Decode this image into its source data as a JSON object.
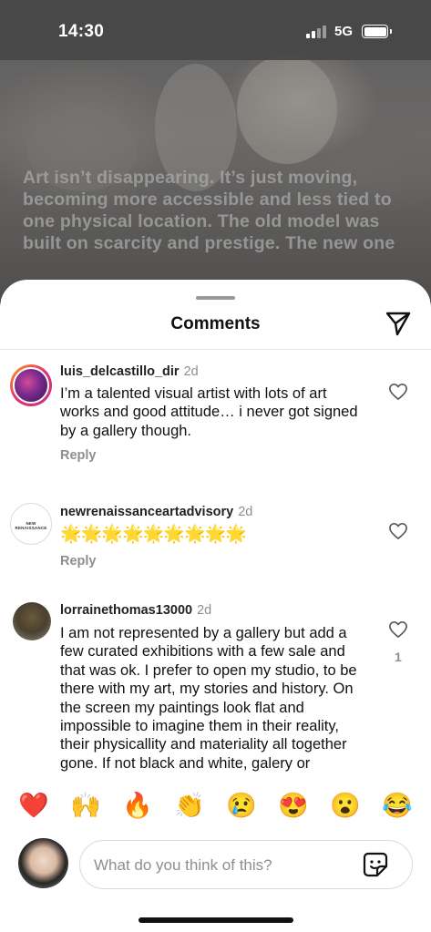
{
  "status_bar": {
    "time": "14:30",
    "network": "5G"
  },
  "post": {
    "caption": "Art isn’t disappearing. It’s just moving, becoming more accessible and less tied to one physical location. The old model was built on scarcity and prestige. The new one"
  },
  "sheet": {
    "title": "Comments",
    "share_icon": "send-icon"
  },
  "comments": [
    {
      "username": "luis_delcastillo_dir",
      "age": "2d",
      "text": "I’m a talented visual artist with lots of art works and good attitude… i never got signed by a gallery though.",
      "reply_label": "Reply",
      "likes": ""
    },
    {
      "username": "newrenaissanceartadvisory",
      "age": "2d",
      "avatar_text": "NEW RENAISSANCE",
      "text": "🌟🌟🌟🌟🌟🌟🌟🌟🌟",
      "reply_label": "Reply",
      "likes": ""
    },
    {
      "username": "lorrainethomas13000",
      "age": "2d",
      "text": "I am not represented by a gallery but add a few curated exhibitions with a few sale and that was ok. I prefer to open my studio, to be there with my art, my stories and history. On the screen my paintings look flat and impossible to imagine them in their reality, their physicallity and materiality all together gone. If not black and white, galery or",
      "likes": "1"
    }
  ],
  "emoji_bar": [
    "❤️",
    "🙌",
    "🔥",
    "👏",
    "😢",
    "😍",
    "😮",
    "😂"
  ],
  "composer": {
    "placeholder": "What do you think of this?",
    "sticker_icon": "sticker-icon"
  },
  "colors": {
    "secondary_text": "#8e8e8e",
    "story_ring_start": "#f9a01b",
    "story_ring_end": "#c13584"
  }
}
